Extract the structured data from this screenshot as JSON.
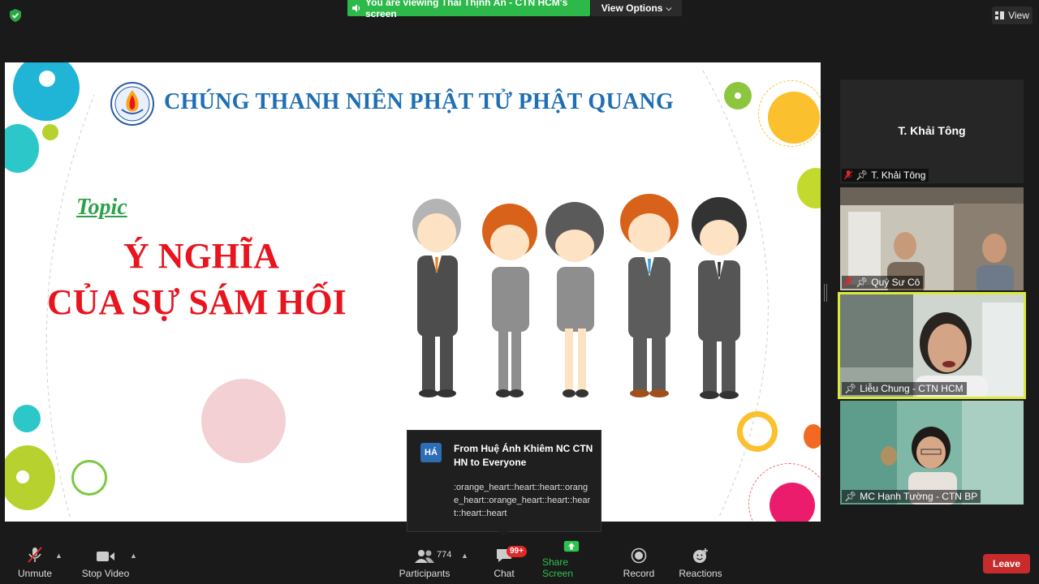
{
  "top_bar": {
    "viewing_text": "You are viewing Thái Thịnh Ân - CTN HCM's screen",
    "view_options_label": "View Options",
    "view_label": "View"
  },
  "slide": {
    "title": "CHÚNG THANH NIÊN PHẬT TỬ PHẬT QUANG",
    "topic_label": "Topic",
    "heading_line1": "Ý NGHĨA",
    "heading_line2": "CỦA SỰ SÁM HỐI"
  },
  "participants": [
    {
      "name": "T. Khải Tông",
      "label": "T. Khải Tông",
      "video": false
    },
    {
      "label": "Quý Sư Cô",
      "video": true
    },
    {
      "label": "Liễu Chung - CTN HCM",
      "video": true,
      "active_speaker": true
    },
    {
      "label": "MC Hạnh Tường - CTN BP",
      "video": true
    }
  ],
  "chat_popup": {
    "avatar_initials": "HÁ",
    "from": "From Huệ Ánh Khiêm NC CTN HN to Everyone",
    "message": ":orange_heart::heart::heart::orange_heart::orange_heart::heart::heart::heart::heart"
  },
  "toolbar": {
    "unmute_label": "Unmute",
    "stop_video_label": "Stop Video",
    "participants_label": "Participants",
    "participants_count": "774",
    "chat_label": "Chat",
    "chat_badge": "99+",
    "share_screen_label": "Share Screen",
    "record_label": "Record",
    "reactions_label": "Reactions",
    "leave_label": "Leave"
  },
  "colors": {
    "banner_green": "#2db84a",
    "leave_red": "#c72b2b",
    "active_speaker_border": "#d9ea3a",
    "slide_title_blue": "#1f6fb4",
    "slide_heading_red": "#e8141e"
  }
}
